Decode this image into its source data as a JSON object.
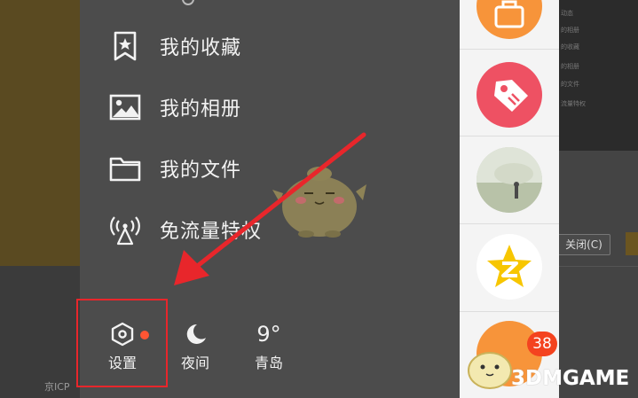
{
  "background": {
    "icp_text": "京ICP",
    "close_button_label": "关闭(C)",
    "right_mini_items": [
      "动态",
      "的相册",
      "的收藏",
      "的相册",
      "的文件",
      "流量特权"
    ]
  },
  "drawer": {
    "menu": [
      {
        "label": "我的收藏",
        "icon": "bookmark-star-icon"
      },
      {
        "label": "我的相册",
        "icon": "image-icon"
      },
      {
        "label": "我的文件",
        "icon": "folder-icon"
      },
      {
        "label": "免流量特权",
        "icon": "signal-tower-icon"
      }
    ],
    "bottom": {
      "settings_label": "设置",
      "night_label": "夜间",
      "weather_temp": "9°",
      "weather_city": "青岛"
    }
  },
  "right_column": {
    "badge_count": "38",
    "avatars": [
      "orange-bag-icon",
      "pink-tag-icon",
      "photo-avatar",
      "qzone-star-icon",
      "orange-avatar"
    ]
  },
  "watermark": {
    "text": "3DMGAME"
  },
  "colors": {
    "drawer_bg": "#4c4c4c",
    "highlight_box": "#e8262b",
    "arrow": "#e8262b",
    "notification_dot": "#ff5533",
    "badge": "#f4431f"
  }
}
